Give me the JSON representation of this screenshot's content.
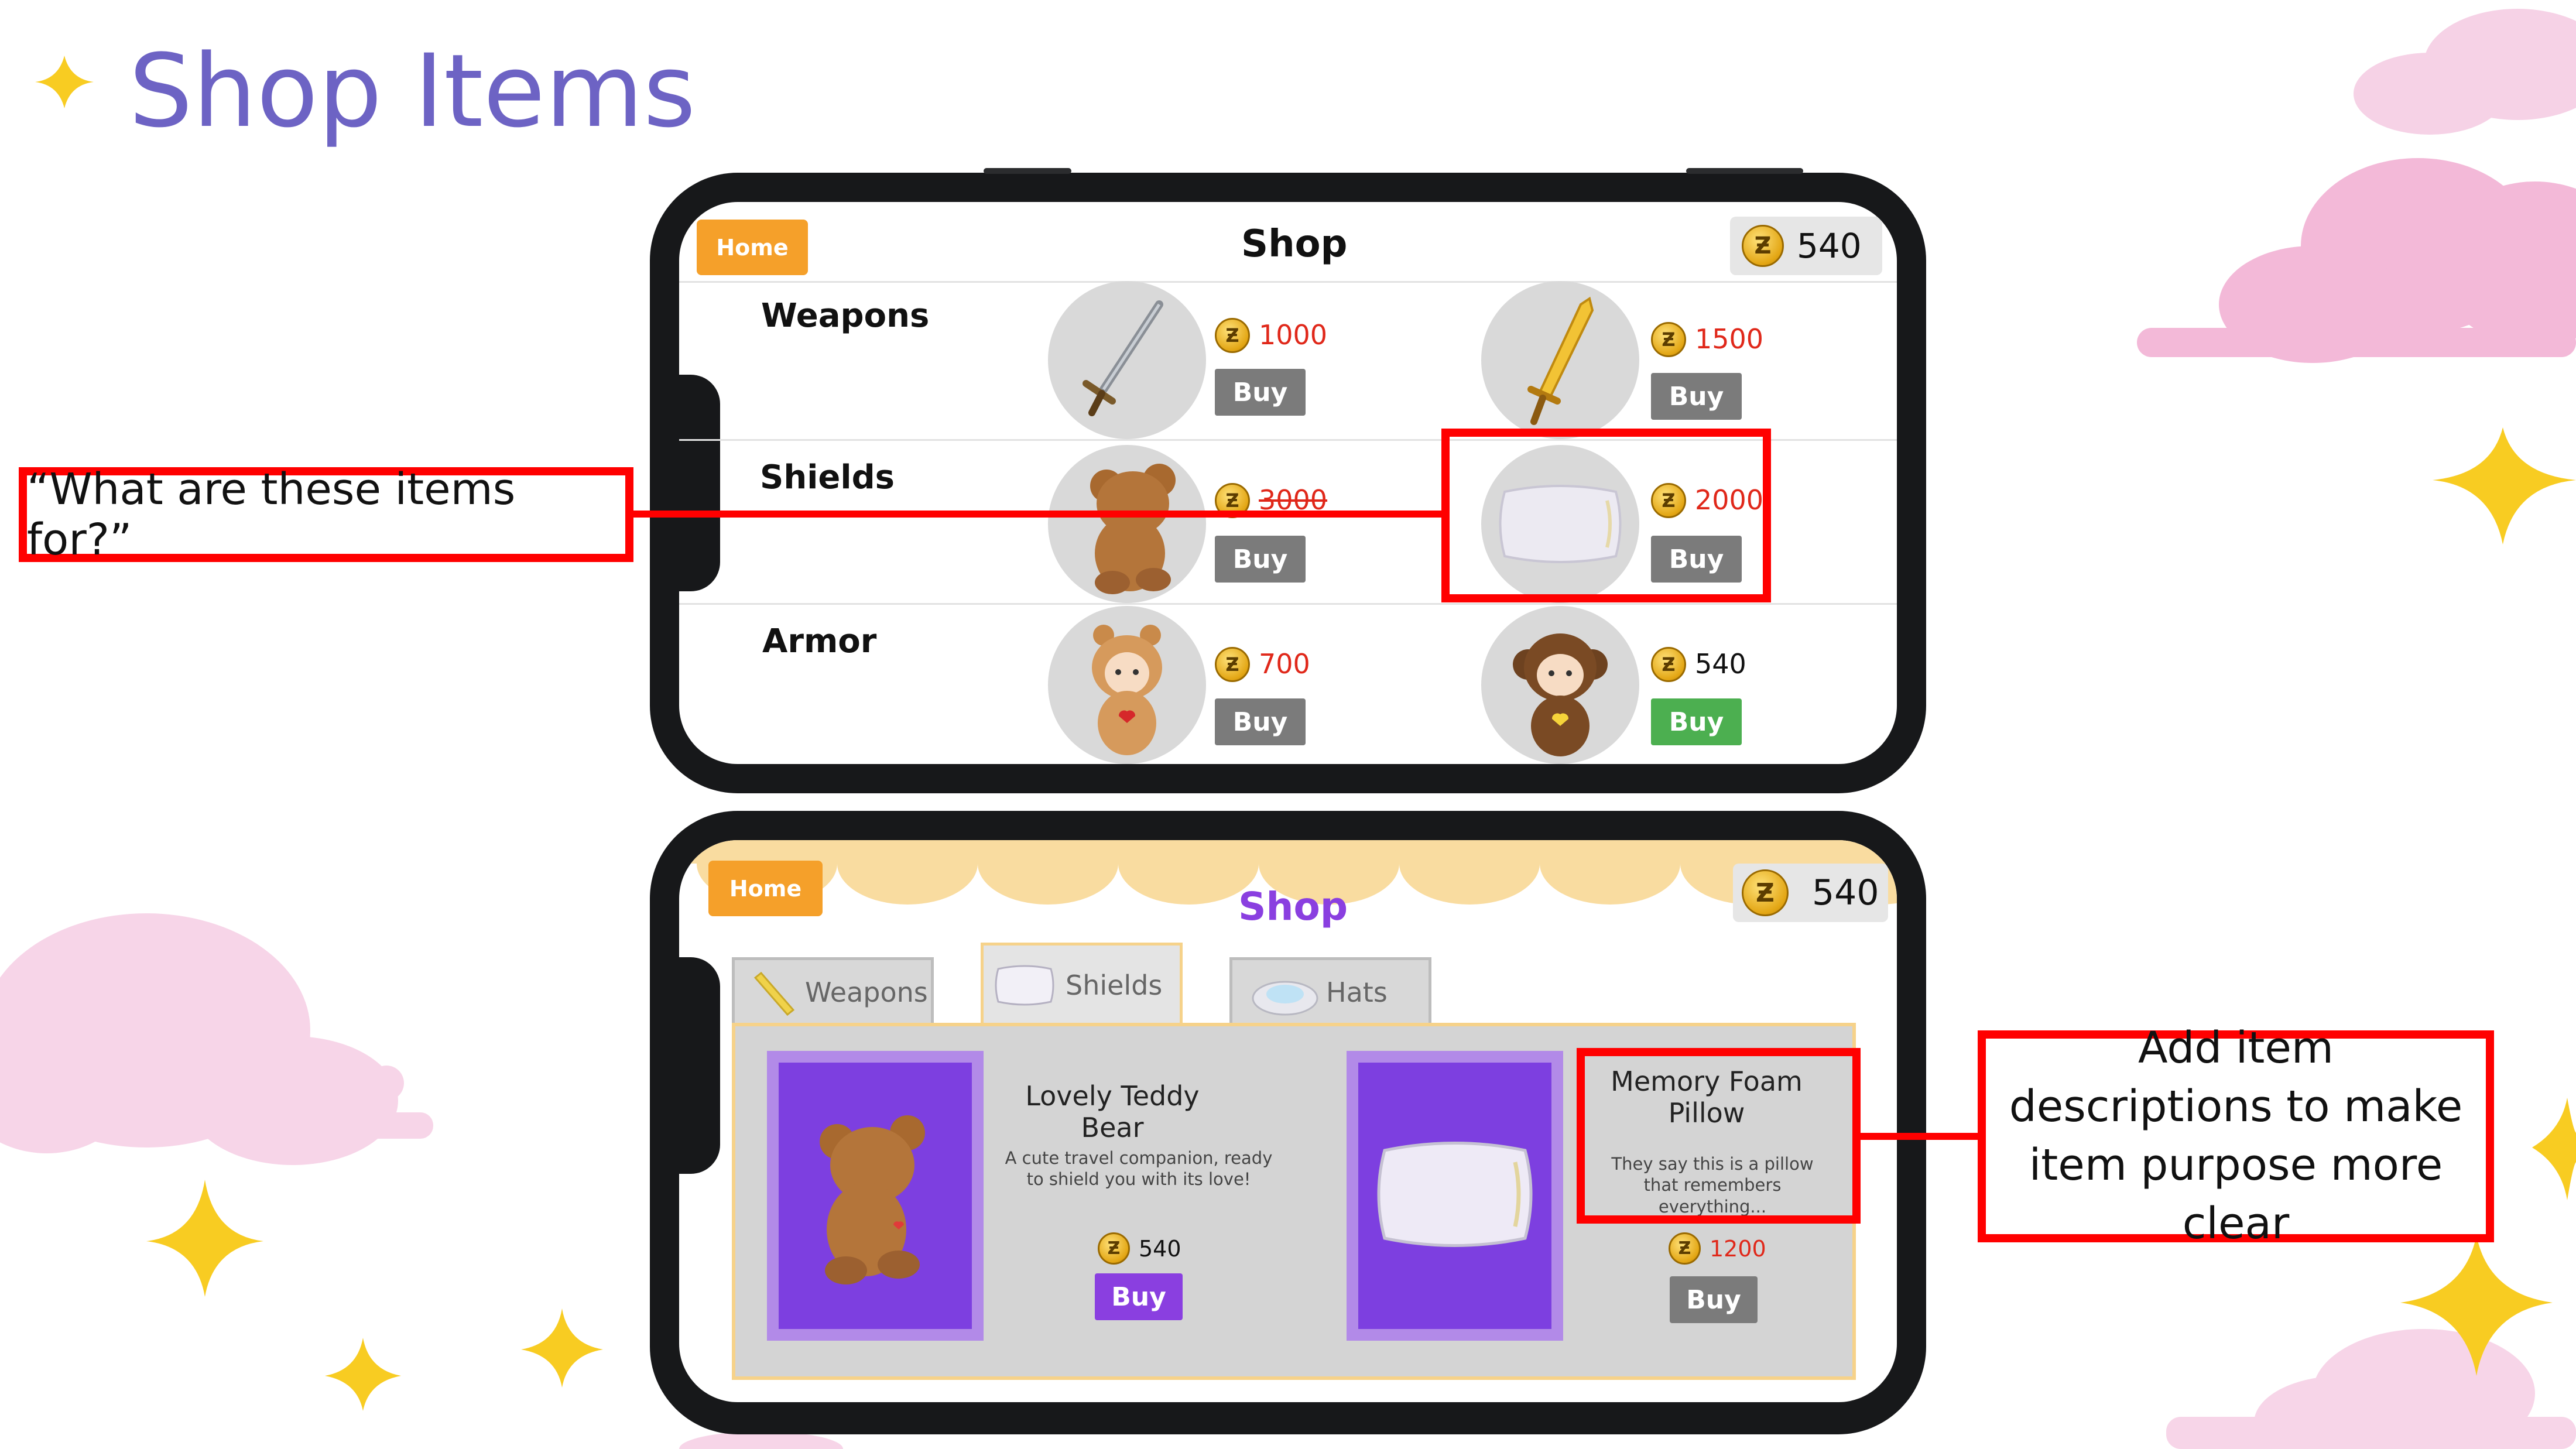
{
  "slide": {
    "title": "Shop Items"
  },
  "top_phone": {
    "home_label": "Home",
    "title": "Shop",
    "coins": "540",
    "categories": [
      {
        "name": "Weapons",
        "items": [
          {
            "icon": "sword-icon",
            "price": "1000",
            "buy": "Buy",
            "affordable": false
          },
          {
            "icon": "golden-sword-icon",
            "price": "1500",
            "buy": "Buy",
            "affordable": false
          }
        ]
      },
      {
        "name": "Shields",
        "items": [
          {
            "icon": "teddy-bear-icon",
            "price": "3000",
            "buy": "Buy",
            "affordable": false
          },
          {
            "icon": "pillow-icon",
            "price": "2000",
            "buy": "Buy",
            "affordable": false
          }
        ]
      },
      {
        "name": "Armor",
        "items": [
          {
            "icon": "reindeer-costume-icon",
            "price": "700",
            "buy": "Buy",
            "affordable": false
          },
          {
            "icon": "monkey-costume-icon",
            "price": "540",
            "buy": "Buy",
            "affordable": true
          }
        ]
      }
    ]
  },
  "bottom_phone": {
    "home_label": "Home",
    "title": "Shop",
    "coins": "540",
    "tabs": [
      {
        "label": "Weapons",
        "icon": "pencil-icon",
        "active": false
      },
      {
        "label": "Shields",
        "icon": "pillow-icon",
        "active": true
      },
      {
        "label": "Hats",
        "icon": "hat-icon",
        "active": false
      }
    ],
    "items": [
      {
        "name": "Lovely Teddy Bear",
        "description": "A cute travel companion, ready to shield you with its love!",
        "price": "540",
        "buy": "Buy",
        "affordable": true,
        "icon": "teddy-bear-icon"
      },
      {
        "name": "Memory Foam Pillow",
        "description": "They say this is a pillow that remembers everything...",
        "price": "1200",
        "buy": "Buy",
        "affordable": false,
        "icon": "pillow-icon"
      }
    ]
  },
  "annotations": {
    "question": "“What are these items for?”",
    "suggestion": "Add item descriptions to make item purpose more clear"
  },
  "colors": {
    "title": "#6d63c4",
    "highlight": "#ff0000",
    "price_red": "#e0281a",
    "buy_green": "#4caf50",
    "buy_purple": "#8a3fe0",
    "home_orange": "#f5a02a"
  }
}
